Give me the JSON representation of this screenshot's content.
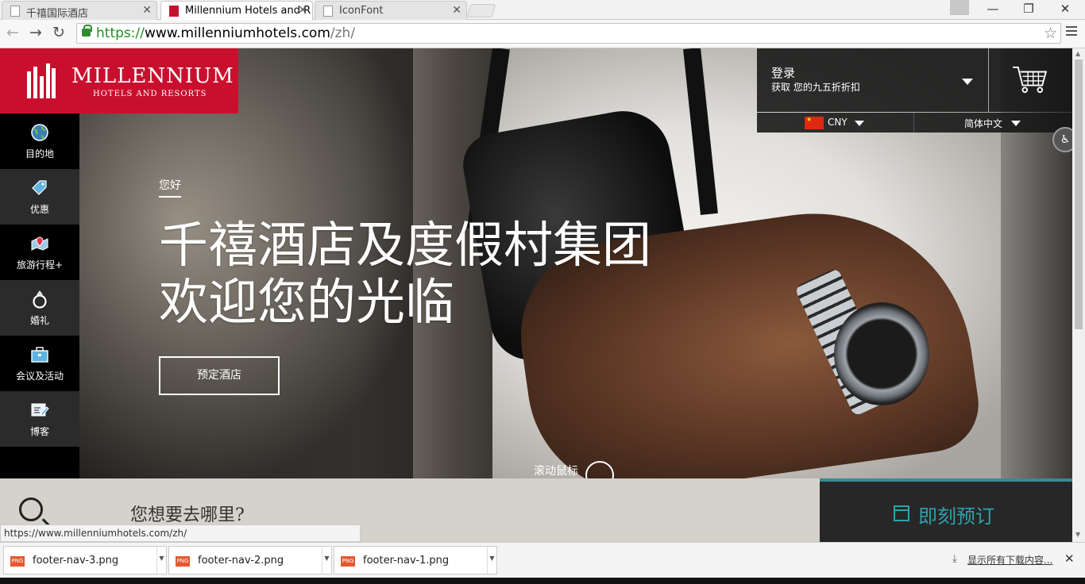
{
  "browser": {
    "tabs": [
      {
        "title": "千禧国际酒店",
        "active": false
      },
      {
        "title": "Millennium Hotels and R",
        "active": true
      },
      {
        "title": "IconFont",
        "active": false
      }
    ],
    "url": {
      "scheme": "https://",
      "host": "www.millenniumhotels.com",
      "path": "/zh/"
    },
    "status_url": "https://www.millenniumhotels.com/zh/"
  },
  "brand": {
    "name": "MILLENNIUM",
    "tagline": "HOTELS AND RESORTS",
    "color": "#c8102e"
  },
  "leftnav": [
    {
      "label": "目的地",
      "icon": "globe-icon"
    },
    {
      "label": "优惠",
      "icon": "tag-icon"
    },
    {
      "label": "旅游行程+",
      "icon": "map-pin-icon"
    },
    {
      "label": "婚礼",
      "icon": "ring-icon"
    },
    {
      "label": "会议及活动",
      "icon": "briefcase-icon"
    },
    {
      "label": "博客",
      "icon": "edit-icon"
    }
  ],
  "account": {
    "login": "登录",
    "discount": "获取 您的九五折折扣"
  },
  "currency": {
    "code": "CNY"
  },
  "language": {
    "label": "简体中文"
  },
  "hero": {
    "greeting": "您好",
    "headline_line1": "千禧酒店及度假村集团",
    "headline_line2": "欢迎您的光临",
    "cta": "预定酒店",
    "scroll_hint": "滚动鼠标"
  },
  "search": {
    "placeholder": "您想要去哪里?"
  },
  "reserve": {
    "label": "即刻预订",
    "color": "#2fa2ad"
  },
  "downloads": [
    {
      "name": "footer-nav-3.png"
    },
    {
      "name": "footer-nav-2.png"
    },
    {
      "name": "footer-nav-1.png"
    }
  ],
  "shelf": {
    "show_all": "显示所有下载内容..."
  }
}
